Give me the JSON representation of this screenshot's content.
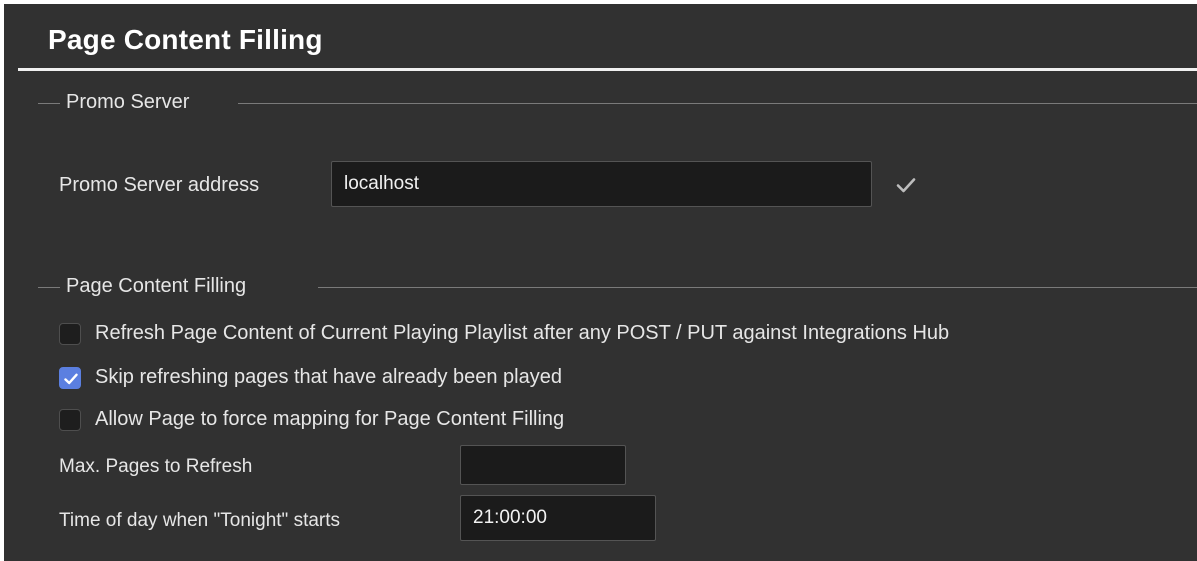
{
  "header": {
    "title": "Page Content Filling"
  },
  "promo_group": {
    "title": "Promo Server",
    "address_label": "Promo Server address",
    "address_value": "localhost",
    "validation_icon": "checkmark-icon"
  },
  "filling_group": {
    "title": "Page Content Filling",
    "options": [
      {
        "label": "Refresh Page Content of Current Playing Playlist after any POST / PUT against Integrations Hub",
        "checked": false
      },
      {
        "label": "Skip refreshing pages that have already been played",
        "checked": true
      },
      {
        "label": "Allow Page to force mapping for Page Content Filling",
        "checked": false
      }
    ],
    "max_pages_label": "Max. Pages to Refresh",
    "max_pages_value": "",
    "tonight_label": "Time of day when \"Tonight\" starts",
    "tonight_value": "21:00:00"
  },
  "colors": {
    "panel_bg": "#313131",
    "input_bg": "#1b1b1b",
    "accent_checked": "#5b7fe0"
  }
}
